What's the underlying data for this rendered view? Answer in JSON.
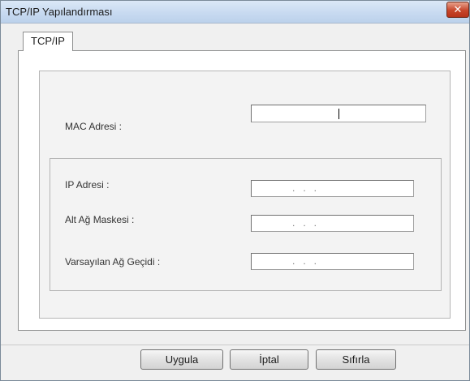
{
  "window": {
    "title": "TCP/IP Yapılandırması",
    "close_glyph": "✕"
  },
  "tabs": [
    {
      "label": "TCP/IP"
    }
  ],
  "fields": {
    "mac_address": {
      "label": "MAC Adresi :",
      "value": ""
    },
    "ip_address": {
      "label": "IP Adresi :",
      "value": ".   .   ."
    },
    "subnet_mask": {
      "label": "Alt Ağ Maskesi :",
      "value": ".   .   ."
    },
    "default_gateway": {
      "label": "Varsayılan Ağ Geçidi :",
      "value": ".   .   ."
    }
  },
  "buttons": {
    "apply": "Uygula",
    "cancel": "İptal",
    "reset": "Sıfırla"
  }
}
